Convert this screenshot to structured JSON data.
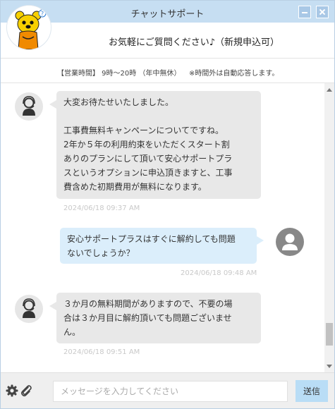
{
  "window": {
    "title": "チャットサポート"
  },
  "header": {
    "subtitle": "お気軽にご質問ください♪（新規申込可）"
  },
  "hours": {
    "label": "【営業時間】 9時～20時 （年中無休）",
    "note": "※時間外は自動応答します。"
  },
  "messages": [
    {
      "sender": "operator",
      "lines": [
        "大変お待たせいたしました。",
        "",
        "工事費無料キャンペーンについてですね。",
        "2年か５年の利用約束をいただくスタート割",
        "ありのプランにして頂いて安心サポートプラ",
        "スというオプションに申込頂きますと、工事",
        "費含めた初期費用が無料になります。"
      ],
      "time": "2024/06/18 09:37 AM"
    },
    {
      "sender": "user",
      "lines": [
        "安心サポートプラスはすぐに解約しても問題",
        "ないでしょうか？"
      ],
      "time": "2024/06/18 09:48 AM"
    },
    {
      "sender": "operator",
      "lines": [
        "３か月の無料期間がありますので、不要の場",
        "合は３か月目に解約頂いても問題ございませ",
        "ん。"
      ],
      "time": "2024/06/18 09:51 AM"
    }
  ],
  "footer": {
    "placeholder": "メッセージを入力してください",
    "send_label": "送信"
  },
  "colors": {
    "titlebar": "#c6def2",
    "operator_bubble": "#e8e8e8",
    "user_bubble": "#dbeefb",
    "send_button": "#b9ddf6"
  },
  "icons": [
    "mascot-logo",
    "operator-avatar-icon",
    "user-avatar-icon",
    "gear-icon",
    "paperclip-icon",
    "minimize-icon",
    "close-icon"
  ]
}
